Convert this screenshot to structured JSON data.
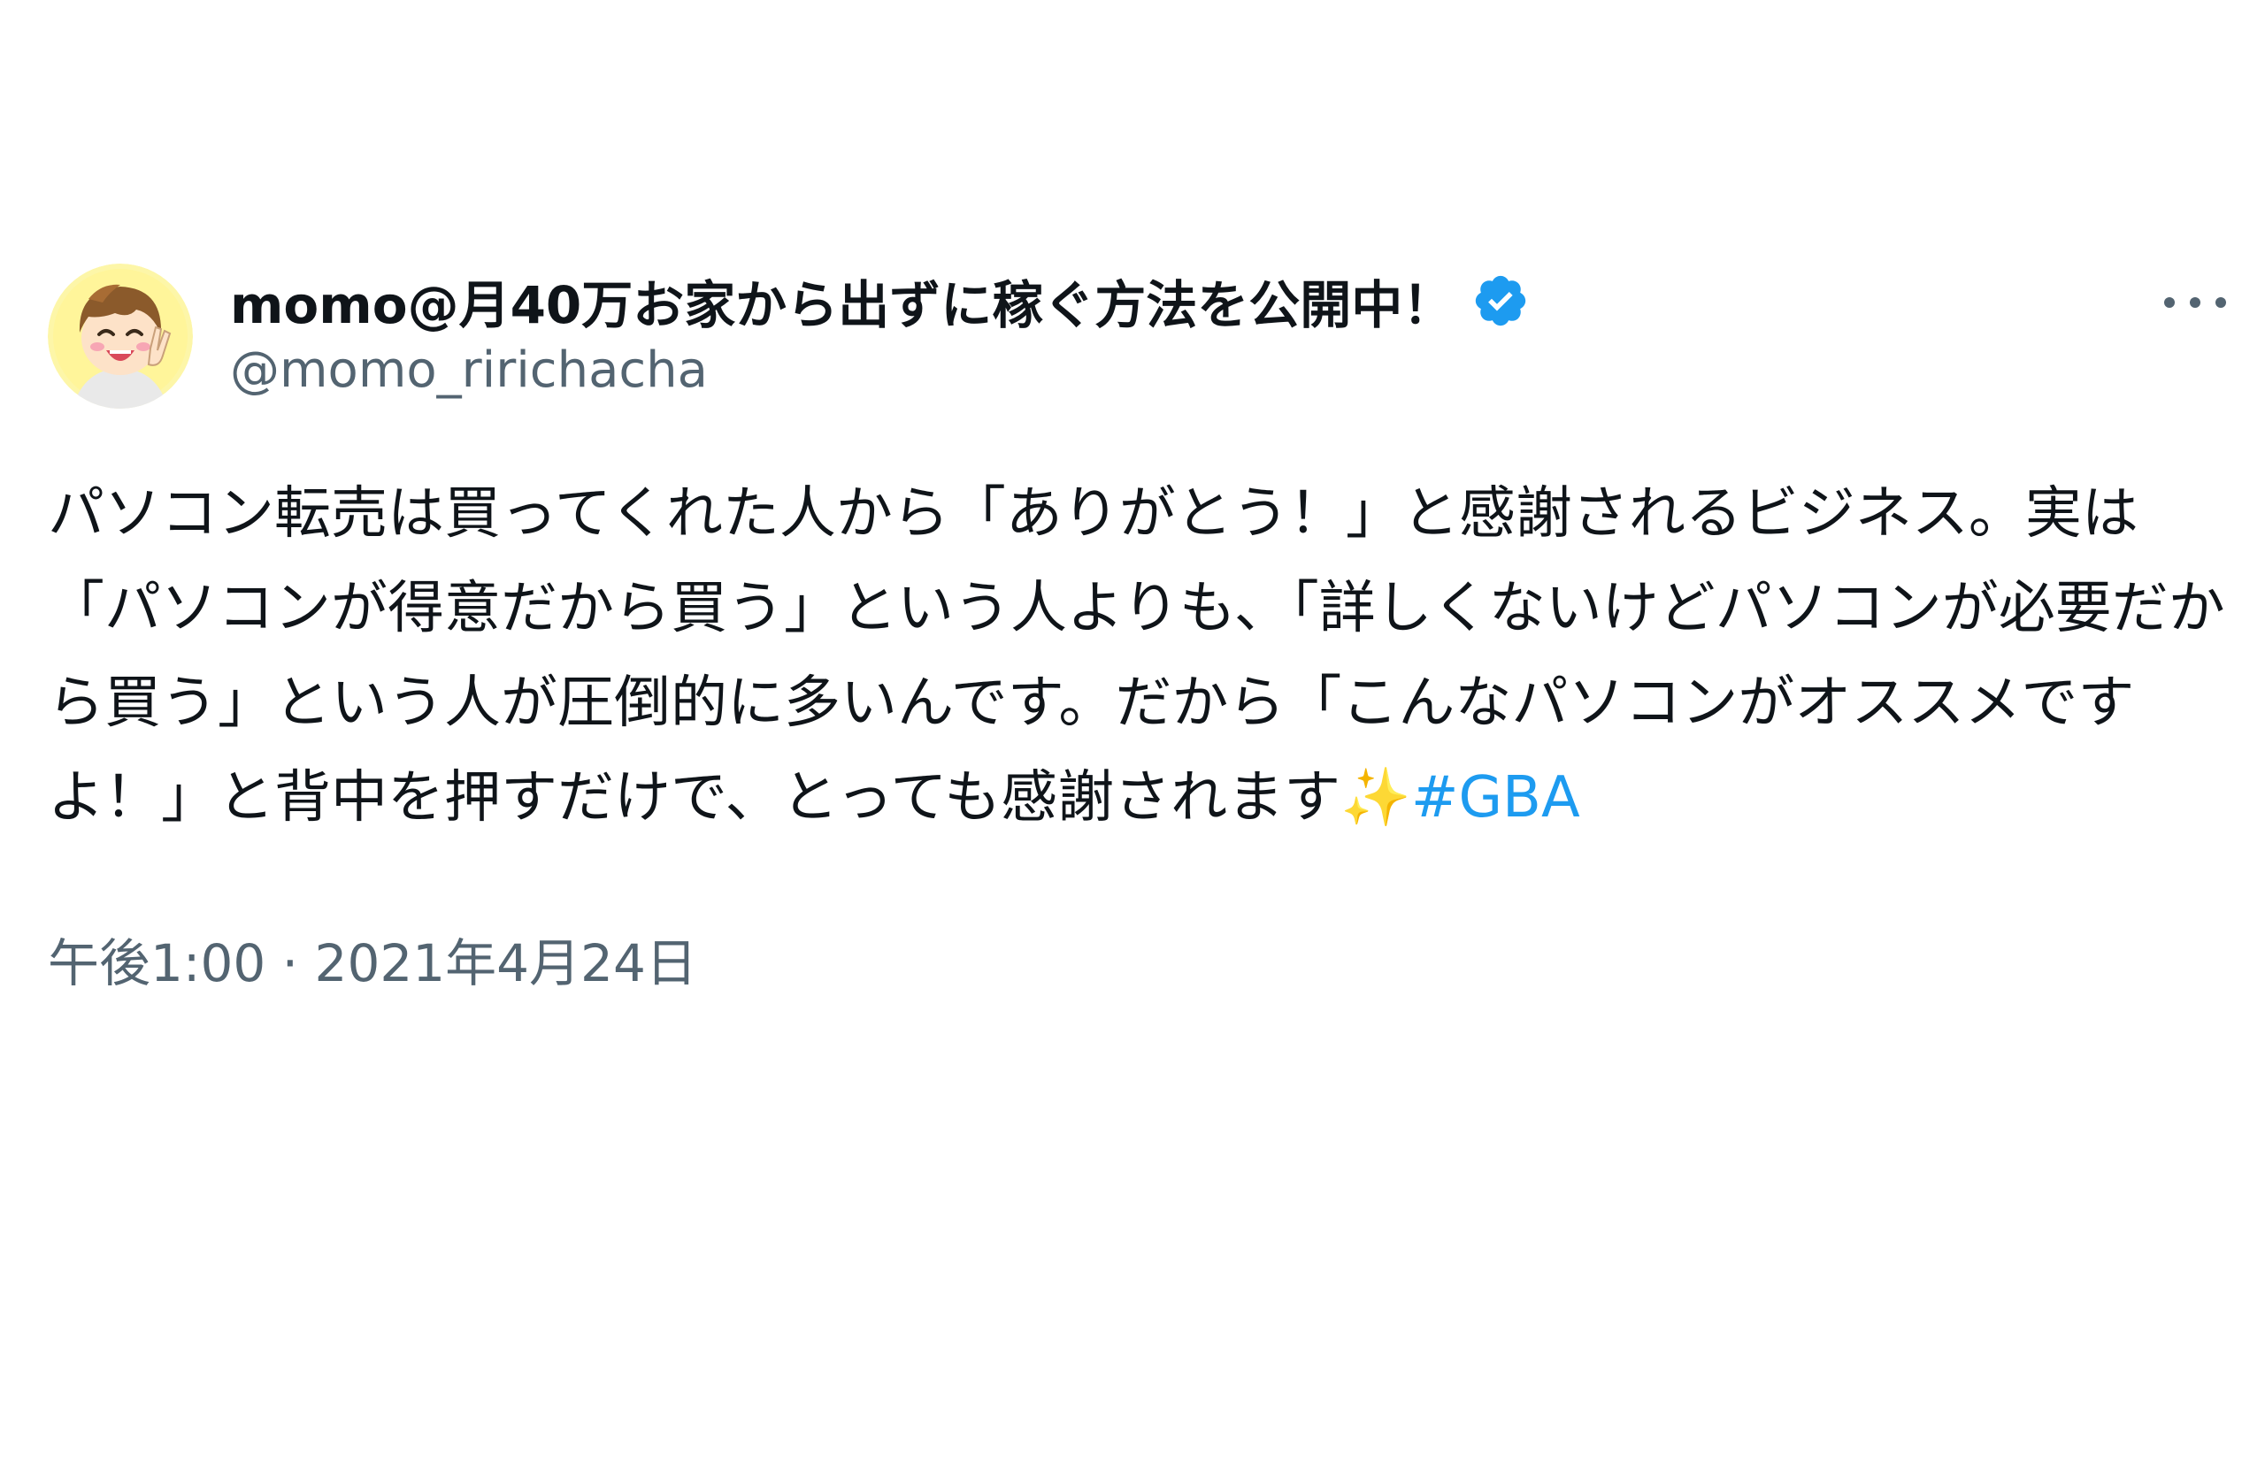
{
  "tweet": {
    "display_name": "momo@月40万お家から出ずに稼ぐ方法を公開中！",
    "handle": "@momo_ririchacha",
    "verified": true,
    "avatar_icon": "avatar-cartoon-boy",
    "more_icon": "more-horizontal-icon",
    "text": "パソコン転売は買ってくれた人から「ありがとう！」と感謝されるビジネス。実は「パソコンが得意だから買う」という人よりも、「詳しくないけどパソコンが必要だから買う」という人が圧倒的に多いんです。だから「こんなパソコンがオススメですよ！」と背中を押すだけで、とっても感謝されます",
    "emoji": "✨",
    "hashtag": "#GBA",
    "timestamp": "午後1:00 · 2021年4月24日"
  },
  "colors": {
    "text": "#0f1419",
    "secondary": "#536471",
    "link": "#1d9bf0",
    "verified_badge": "#1d9bf0"
  }
}
